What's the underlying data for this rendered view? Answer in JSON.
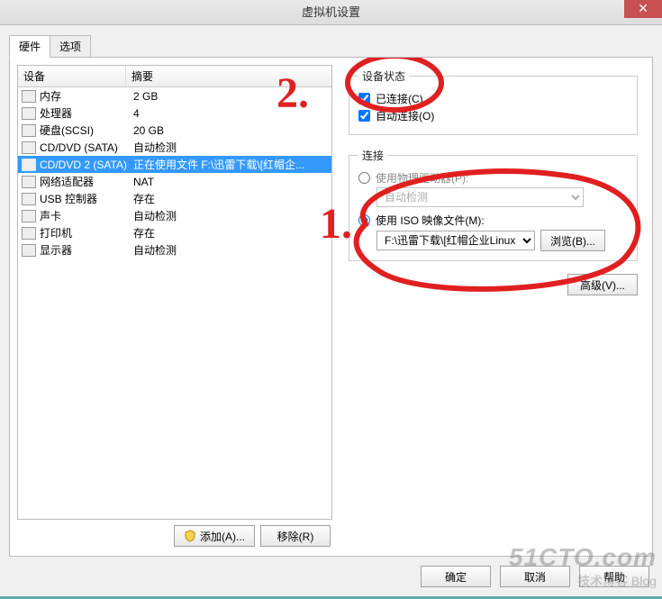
{
  "window": {
    "title": "虚拟机设置",
    "close": "✕"
  },
  "tabs": {
    "hardware": "硬件",
    "options": "选项"
  },
  "hw_head": {
    "device": "设备",
    "summary": "摘要"
  },
  "hw_rows": [
    {
      "dev": "内存",
      "sum": "2 GB"
    },
    {
      "dev": "处理器",
      "sum": "4"
    },
    {
      "dev": "硬盘(SCSI)",
      "sum": "20 GB"
    },
    {
      "dev": "CD/DVD (SATA)",
      "sum": "自动检测"
    },
    {
      "dev": "CD/DVD 2 (SATA)",
      "sum": "正在使用文件 F:\\迅雷下载\\[红帽企..."
    },
    {
      "dev": "网络适配器",
      "sum": "NAT"
    },
    {
      "dev": "USB 控制器",
      "sum": "存在"
    },
    {
      "dev": "声卡",
      "sum": "自动检测"
    },
    {
      "dev": "打印机",
      "sum": "存在"
    },
    {
      "dev": "显示器",
      "sum": "自动检测"
    }
  ],
  "selected_index": 4,
  "left_buttons": {
    "add": "添加(A)...",
    "remove": "移除(R)"
  },
  "status_group": {
    "legend": "设备状态",
    "connected_label": "已连接(C)",
    "connected_key": "C",
    "power_label_pre": "自动",
    "power_label_post": "连接(O)",
    "power_key": "O"
  },
  "conn_group": {
    "legend": "连接",
    "use_physical": "使用物理驱动器(P):",
    "use_physical_key": "P",
    "physical_value": "自动检测",
    "use_iso": "使用 ISO 映像文件(M):",
    "use_iso_key": "M",
    "iso_value": "F:\\迅雷下载\\[红帽企业Linux.",
    "browse": "浏览(B)...",
    "browse_key": "B",
    "advanced": "高级(V)...",
    "advanced_key": "V"
  },
  "dlg": {
    "ok": "确定",
    "cancel": "取消",
    "help": "帮助"
  },
  "annot": {
    "n1": "1.",
    "n2": "2."
  },
  "watermark": {
    "line1": "51CTO.com",
    "line2": "技术博客   Blog"
  }
}
